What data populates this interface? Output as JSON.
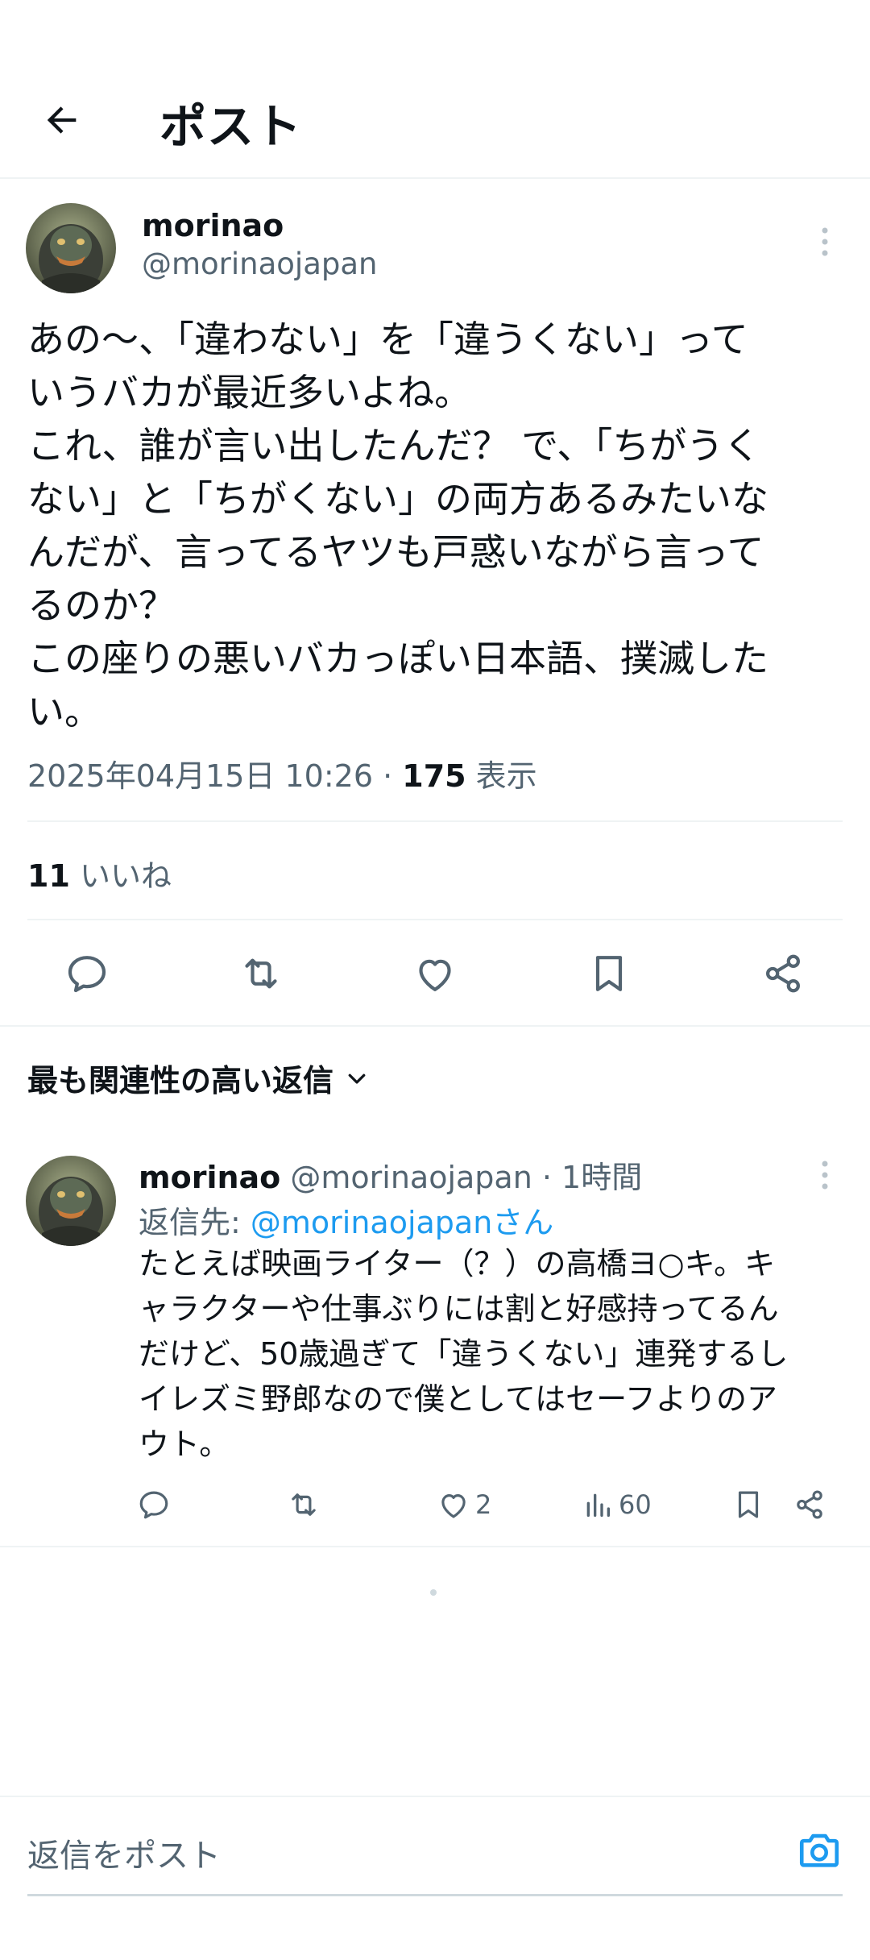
{
  "header": {
    "title": "ポスト"
  },
  "post": {
    "author_name": "morinao",
    "author_handle": "@morinaojapan",
    "text": "あの〜、「違わない」を「違うくない」って\nいうバカが最近多いよね。\nこれ、誰が言い出したんだ？ で、「ちがうく\nない」と「ちがくない」の両方あるみたいな\nんだが、言ってるヤツも戸惑いながら言って\nるのか？\nこの座りの悪いバカっぽい日本語、撲滅した\nい。",
    "timestamp": "2025年04月15日 10:26",
    "separator": " · ",
    "views_count": "175",
    "views_label": " 表示",
    "likes_count": "11",
    "likes_label": " いいね"
  },
  "actions": {
    "icons": [
      "reply-icon",
      "repost-icon",
      "like-icon",
      "bookmark-icon",
      "share-icon"
    ]
  },
  "replies_sort": {
    "label": "最も関連性の高い返信"
  },
  "reply": {
    "author_name": "morinao",
    "author_handle": "@morinaojapan",
    "time": " · 1時間",
    "reply_to_prefix": "返信先: ",
    "reply_to_link": "@morinaojapanさん",
    "text": "たとえば映画ライター（？）の高橋ヨ○キ。キ\nャラクターや仕事ぶりには割と好感持ってるん\nだけど、50歳過ぎて「違うくない」連発するし\nイレズミ野郎なので僕としてはセーフよりのア\nウト。",
    "likes": "2",
    "views": "60"
  },
  "composer": {
    "placeholder": "返信をポスト"
  },
  "colors": {
    "text": "#0f1419",
    "secondary": "#536471",
    "link": "#1d9bf0",
    "divider": "#eff3f4"
  }
}
